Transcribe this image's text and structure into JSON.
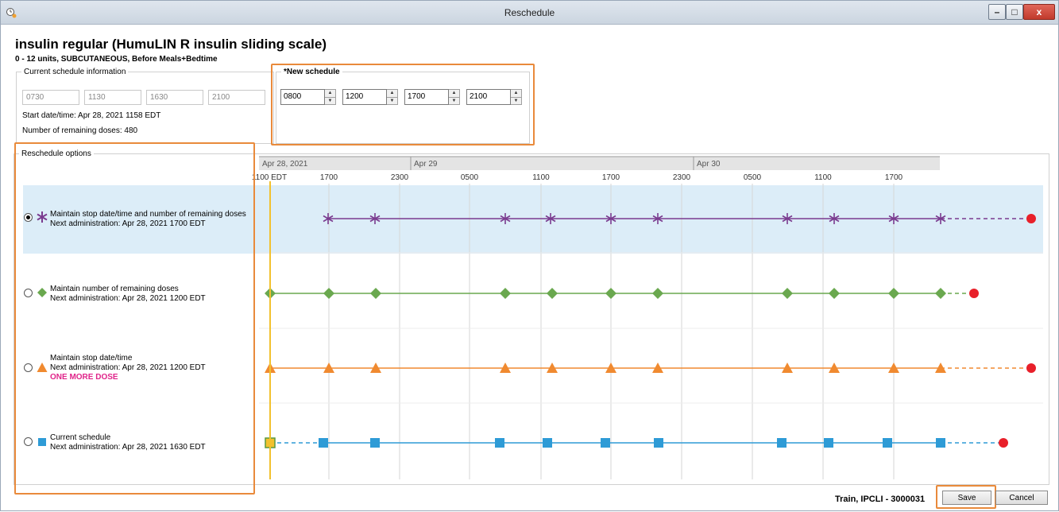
{
  "window": {
    "title": "Reschedule",
    "minimize_icon": "minimize-icon",
    "maximize_icon": "maximize-icon",
    "close_icon": "close-icon"
  },
  "medication": {
    "name": "insulin regular (HumuLIN R insulin sliding scale)",
    "detail": "0 - 12 units, SUBCUTANEOUS, Before Meals+Bedtime"
  },
  "current_schedule": {
    "legend": "Current schedule information",
    "times": [
      "0730",
      "1130",
      "1630",
      "2100"
    ],
    "start": "Start date/time: Apr 28, 2021 1158 EDT",
    "remaining": "Number of remaining doses: 480"
  },
  "new_schedule": {
    "legend": "*New schedule",
    "times": [
      "0800",
      "1200",
      "1700",
      "2100"
    ]
  },
  "reschedule": {
    "legend": "Reschedule options",
    "options": [
      {
        "label": "Maintain stop date/time and number of remaining doses",
        "next": "Next administration: Apr 28, 2021 1700 EDT",
        "symbol": "asterisk",
        "color": "#7a3b8f",
        "selected": true
      },
      {
        "label": "Maintain number of remaining doses",
        "next": "Next administration: Apr 28, 2021 1200 EDT",
        "symbol": "diamond",
        "color": "#6aa84f",
        "selected": false
      },
      {
        "label": "Maintain stop date/time",
        "next": "Next administration: Apr 28, 2021 1200 EDT",
        "warning": "ONE MORE DOSE",
        "symbol": "triangle",
        "color": "#f08a30",
        "selected": false
      },
      {
        "label": "Current schedule",
        "next": "Next administration: Apr 28, 2021 1630 EDT",
        "symbol": "square",
        "color": "#2e9bd6",
        "selected": false
      }
    ]
  },
  "timeline": {
    "dates": [
      "Apr 28, 2021",
      "Apr 29",
      "Apr 30"
    ],
    "now_label": "1100 EDT",
    "ticks": [
      "1700",
      "2300",
      "0500",
      "1100",
      "1700",
      "2300",
      "0500",
      "1100",
      "1700"
    ],
    "current_color": "#f2c12e",
    "stop_color": "#e8202a"
  },
  "footer": {
    "user": "Train, IPCLI - 3000031",
    "save": "Save",
    "cancel": "Cancel"
  },
  "colors": {
    "highlight": "#e98a3b",
    "selected_row": "#dcedf8"
  }
}
